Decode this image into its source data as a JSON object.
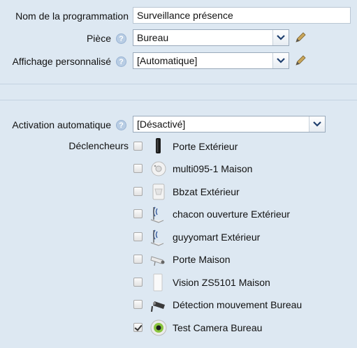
{
  "form": {
    "name_label": "Nom de la programmation",
    "name_value": "Surveillance présence",
    "room_label": "Pièce",
    "room_value": "Bureau",
    "display_label": "Affichage personnalisé",
    "display_value": "[Automatique]",
    "activation_label": "Activation automatique",
    "activation_value": "[Désactivé]",
    "triggers_label": "Déclencheurs",
    "help_glyph": "?"
  },
  "triggers": [
    {
      "name": "Porte Extérieur",
      "icon": "door-sensor-icon",
      "checked": false
    },
    {
      "name": "multi095-1 Maison",
      "icon": "multisensor-icon",
      "checked": false
    },
    {
      "name": "Bbzat Extérieur",
      "icon": "motion-sensor-icon",
      "checked": false
    },
    {
      "name": "chacon ouverture Extérieur",
      "icon": "radio-signal-icon",
      "checked": false
    },
    {
      "name": "guyyomart Extérieur",
      "icon": "radio-signal-icon",
      "checked": false
    },
    {
      "name": "Porte Maison",
      "icon": "camera-icon",
      "checked": false
    },
    {
      "name": "Vision ZS5101 Maison",
      "icon": "sensor-panel-icon",
      "checked": false
    },
    {
      "name": "Détection mouvement Bureau",
      "icon": "security-camera-icon",
      "checked": false
    },
    {
      "name": "Test Camera Bureau",
      "icon": "webcam-icon",
      "checked": true
    }
  ],
  "colors": {
    "background": "#dde8f2",
    "select_arrow": "#1f3f6e"
  }
}
